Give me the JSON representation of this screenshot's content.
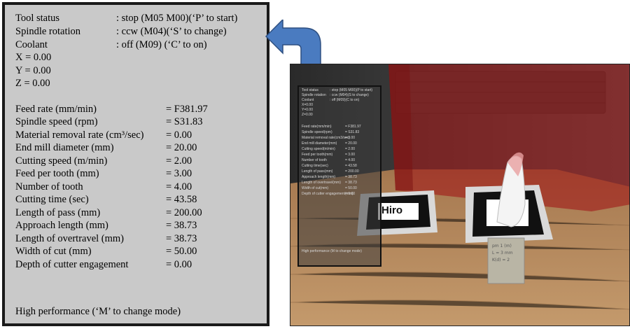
{
  "status": [
    {
      "label": "Tool status",
      "value": ": stop (M05 M00)(‘P’ to start)"
    },
    {
      "label": "Spindle rotation",
      "value": ": ccw (M04)(‘S’ to change)"
    },
    {
      "label": "Coolant",
      "value": ": off (M09) (‘C’ to on)"
    }
  ],
  "coords": [
    {
      "label": "X = 0.00"
    },
    {
      "label": "Y = 0.00"
    },
    {
      "label": "Z = 0.00"
    }
  ],
  "params": [
    {
      "label": "Feed rate (mm/min)",
      "value": "= F381.97"
    },
    {
      "label": "Spindle speed (rpm)",
      "value": "= S31.83"
    },
    {
      "label": "Material removal rate (cm³/sec)",
      "value": "= 0.00"
    },
    {
      "label": "End mill diameter (mm)",
      "value": "= 20.00"
    },
    {
      "label": "Cutting speed (m/min)",
      "value": "= 2.00"
    },
    {
      "label": "Feed per tooth (mm)",
      "value": "= 3.00"
    },
    {
      "label": "Number of tooth",
      "value": "= 4.00"
    },
    {
      "label": "Cutting time (sec)",
      "value": "= 43.58"
    },
    {
      "label": "Length of pass (mm)",
      "value": "= 200.00"
    },
    {
      "label": "Approach length (mm)",
      "value": "= 38.73"
    },
    {
      "label": "Length of overtravel (mm)",
      "value": "= 38.73"
    },
    {
      "label": "Width of cut (mm)",
      "value": "= 50.00"
    },
    {
      "label": "Depth of cutter engagement",
      "value": "= 0.00"
    }
  ],
  "footer": "High performance (‘M’ to change mode)",
  "photo": {
    "marker_label": "Hiro",
    "tag_lines": [
      "pm 1 (m)",
      "L = 3 mm",
      "K(d) = 2"
    ],
    "mini_panel": {
      "status": [
        {
          "label": "Tool status",
          "value": ": stop (M05 M00)(P to start)"
        },
        {
          "label": "Spindle rotation",
          "value": ": ccw (M04)(S to change)"
        },
        {
          "label": "Coolant",
          "value": ": off (M09)(C to on)"
        },
        {
          "label": "X=0.00",
          "value": ""
        },
        {
          "label": "Y=0.00",
          "value": ""
        },
        {
          "label": "Z=0.00",
          "value": ""
        }
      ],
      "params": [
        {
          "label": "Feed rate(mm/min)",
          "value": "= F381.97"
        },
        {
          "label": "Spindle speed(rpm)",
          "value": "= S31.83"
        },
        {
          "label": "Material removal rate(cm3/sec)",
          "value": "= 0.00"
        },
        {
          "label": "End mill diameter(mm)",
          "value": "= 20.00"
        },
        {
          "label": "Cutting speed(m/min)",
          "value": "= 2.00"
        },
        {
          "label": "Feed per tooth(mm)",
          "value": "= 3.00"
        },
        {
          "label": "Number of tooth",
          "value": "= 4.00"
        },
        {
          "label": "Cutting time(sec)",
          "value": "= 43.58"
        },
        {
          "label": "Length of pass(mm)",
          "value": "= 200.00"
        },
        {
          "label": "Approach length(mm)",
          "value": "= 38.73"
        },
        {
          "label": "Length of overtravel(mm)",
          "value": "= 38.73"
        },
        {
          "label": "Width of cut(mm)",
          "value": "= 50.00"
        },
        {
          "label": "Depth of cutter engagement(mm)",
          "value": "= 0.00"
        }
      ],
      "footer": "High performance (M to change mode)"
    }
  },
  "colors": {
    "panel_bg": "#c9c9c9",
    "arrow_fill": "#4a7bc0",
    "overlay_red": "#a01818",
    "table_wood": "#a07650"
  }
}
